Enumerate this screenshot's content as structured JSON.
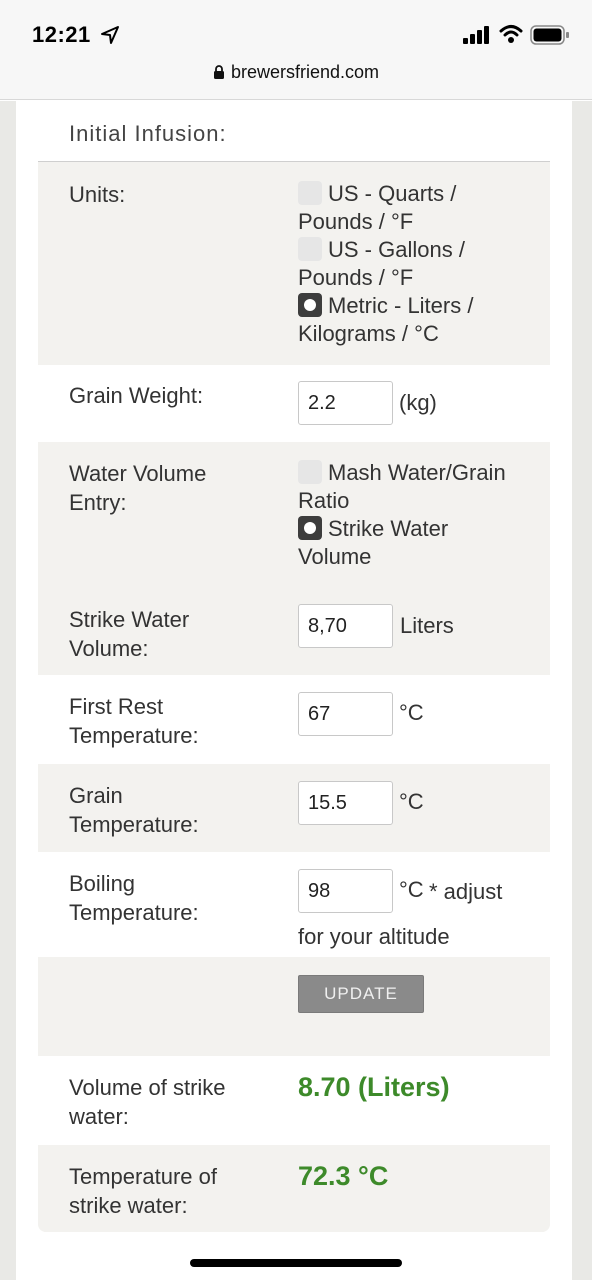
{
  "status_bar": {
    "time": "12:21",
    "icons": [
      "location-arrow-icon",
      "signal-icon",
      "wifi-icon",
      "battery-icon"
    ]
  },
  "browser": {
    "url": "brewersfriend.com"
  },
  "form": {
    "title": "Initial Infusion:",
    "units": {
      "label": "Units:",
      "options": [
        {
          "label": "US - Quarts / Pounds / °F",
          "selected": false
        },
        {
          "label": "US - Gallons / Pounds / °F",
          "selected": false
        },
        {
          "label": "Metric - Liters / Kilograms / °C",
          "selected": true
        }
      ]
    },
    "grain_weight": {
      "label": "Grain Weight:",
      "value": "2.2",
      "unit": "(kg)"
    },
    "water_volume_entry": {
      "label": "Water Volume Entry:",
      "options": [
        {
          "label": "Mash Water/Grain Ratio",
          "selected": false
        },
        {
          "label": "Strike Water Volume",
          "selected": true
        }
      ]
    },
    "strike_water_volume": {
      "label": "Strike Water Volume:",
      "value": "8,70",
      "unit": "Liters"
    },
    "first_rest_temperature": {
      "label": "First Rest Temperature:",
      "value": "67",
      "unit": "°C"
    },
    "grain_temperature": {
      "label": "Grain Temperature:",
      "value": "15.5",
      "unit": "°C"
    },
    "boiling_temperature": {
      "label": "Boiling Temperature:",
      "value": "98",
      "unit": "°C",
      "note": "* adjust for your altitude"
    },
    "update_button": "UPDATE"
  },
  "results": {
    "volume": {
      "label": "Volume of strike water:",
      "value": "8.70 (Liters)"
    },
    "temperature": {
      "label": "Temperature of strike water:",
      "value": "72.3 °C"
    }
  },
  "colors": {
    "result_green": "#3d8a2a",
    "row_alt": "#f3f2ef",
    "button_gray": "#8a8a8a"
  }
}
